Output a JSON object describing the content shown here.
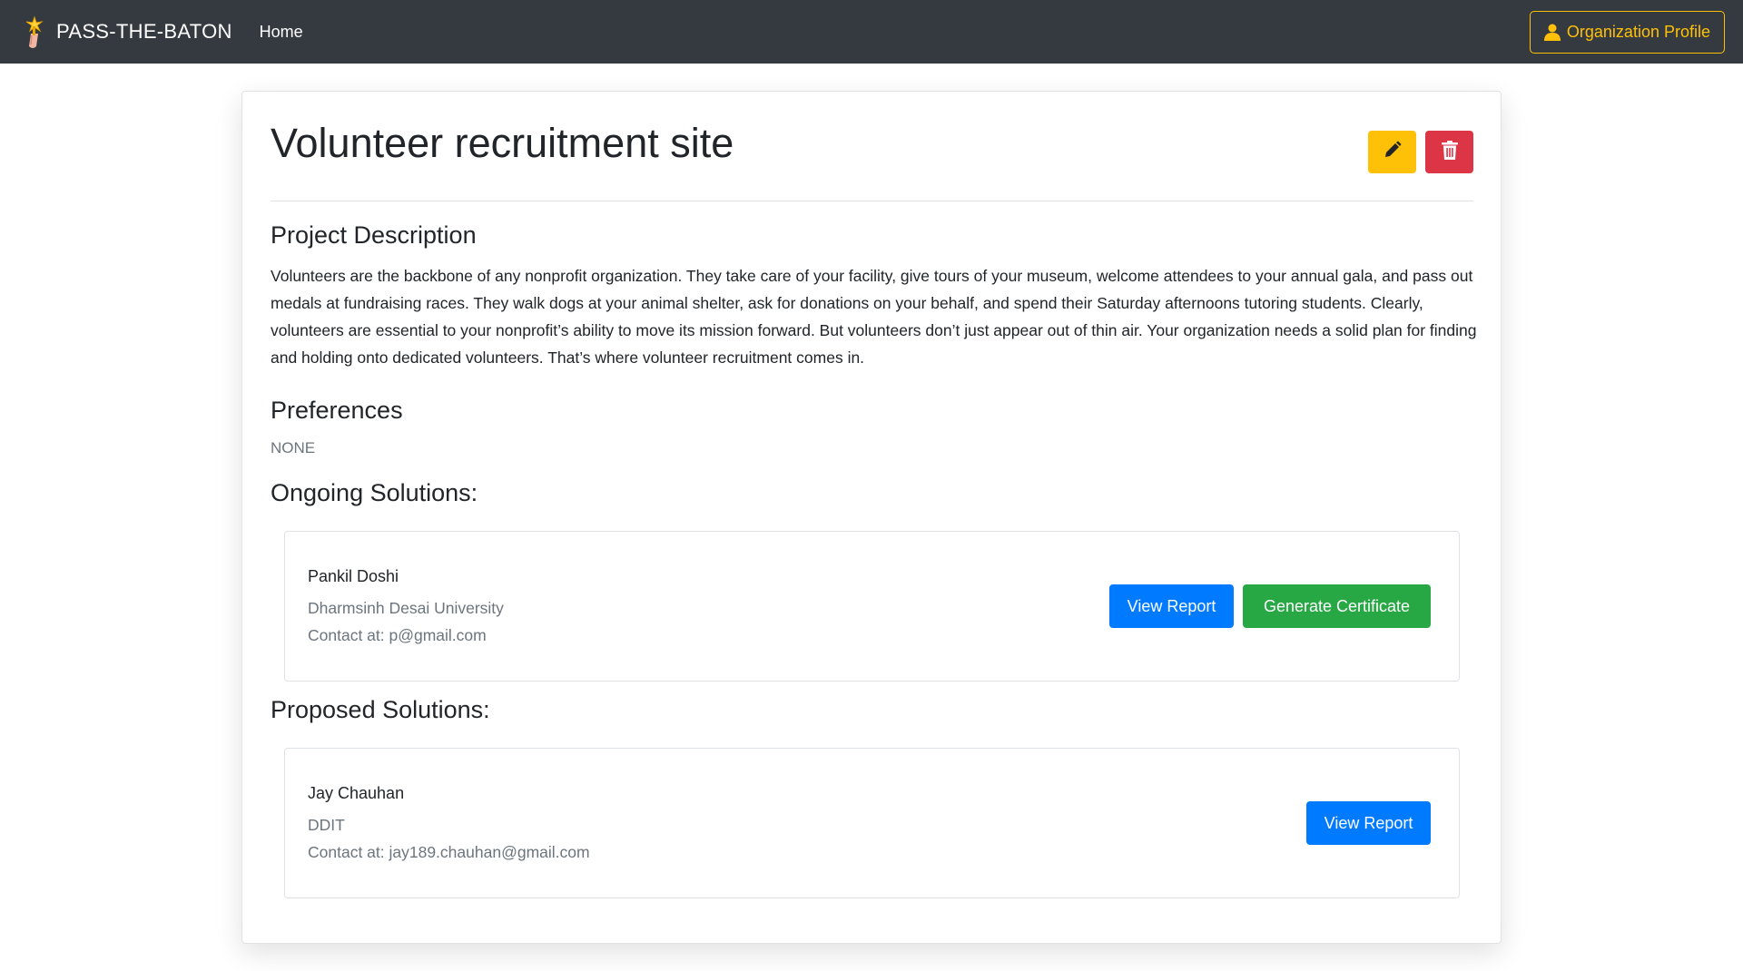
{
  "navbar": {
    "brand": "PASS-THE-BATON",
    "home_label": "Home",
    "profile_label": "Organization Profile"
  },
  "project": {
    "title": "Volunteer recruitment site",
    "description_heading": "Project Description",
    "description": "Volunteers are the backbone of any nonprofit organization. They take care of your facility, give tours of your museum, welcome attendees to your annual gala, and pass out medals at fundraising races. They walk dogs at your animal shelter, ask for donations on your behalf, and spend their Saturday afternoons tutoring students. Clearly, volunteers are essential to your nonprofit’s ability to move its mission forward. But volunteers don’t just appear out of thin air. Your organization needs a solid plan for finding and holding onto dedicated volunteers. That’s where volunteer recruitment comes in.",
    "preferences_heading": "Preferences",
    "preferences_value": "NONE"
  },
  "ongoing": {
    "heading": "Ongoing Solutions:",
    "items": [
      {
        "name": "Pankil Doshi",
        "organization": "Dharmsinh Desai University",
        "contact": "Contact at: p@gmail.com",
        "view_label": "View Report",
        "certificate_label": "Generate Certificate"
      }
    ]
  },
  "proposed": {
    "heading": "Proposed Solutions:",
    "items": [
      {
        "name": "Jay Chauhan",
        "organization": "DDIT",
        "contact": "Contact at: jay189.chauhan@gmail.com",
        "view_label": "View Report"
      }
    ]
  },
  "icons": {
    "brand": "baton-hand-icon",
    "profile": "user-icon",
    "edit": "pencil-icon",
    "delete": "trash-icon"
  },
  "colors": {
    "navbar": "#343a40",
    "warning": "#ffc107",
    "danger": "#dc3545",
    "primary": "#007bff",
    "success": "#28a745"
  }
}
